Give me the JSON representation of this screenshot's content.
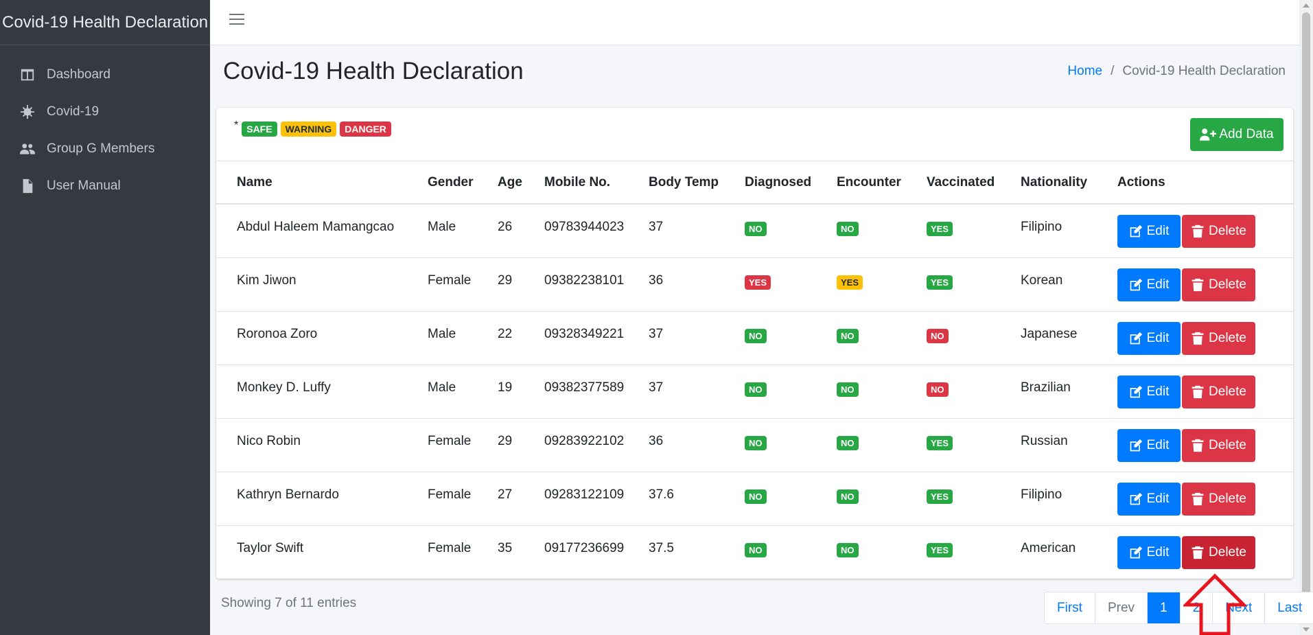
{
  "sidebar": {
    "brand": "Covid-19 Health Declaration",
    "items": [
      {
        "label": "Dashboard",
        "icon": "columns-icon"
      },
      {
        "label": "Covid-19",
        "icon": "virus-icon"
      },
      {
        "label": "Group G Members",
        "icon": "users-icon"
      },
      {
        "label": "User Manual",
        "icon": "file-icon"
      }
    ]
  },
  "header": {
    "title": "Covid-19 Health Declaration",
    "breadcrumb": {
      "home": "Home",
      "separator": "/",
      "current": "Covid-19 Health Declaration"
    }
  },
  "legend": {
    "star": "*",
    "safe": "SAFE",
    "warning": "WARNING",
    "danger": "DANGER"
  },
  "add_button": "Add Data",
  "table": {
    "columns": [
      "Name",
      "Gender",
      "Age",
      "Mobile No.",
      "Body Temp",
      "Diagnosed",
      "Encounter",
      "Vaccinated",
      "Nationality",
      "Actions"
    ],
    "rows": [
      {
        "name": "Abdul Haleem Mamangcao",
        "gender": "Male",
        "age": "26",
        "mobile": "09783944023",
        "temp": "37",
        "diagnosed": "NO",
        "encounter": "NO",
        "vaccinated": "YES",
        "nationality": "Filipino"
      },
      {
        "name": "Kim Jiwon",
        "gender": "Female",
        "age": "29",
        "mobile": "09382238101",
        "temp": "36",
        "diagnosed": "YES",
        "encounter": "YES",
        "vaccinated": "YES",
        "nationality": "Korean"
      },
      {
        "name": "Roronoa Zoro",
        "gender": "Male",
        "age": "22",
        "mobile": "09328349221",
        "temp": "37",
        "diagnosed": "NO",
        "encounter": "NO",
        "vaccinated": "NO",
        "nationality": "Japanese"
      },
      {
        "name": "Monkey D. Luffy",
        "gender": "Male",
        "age": "19",
        "mobile": "09382377589",
        "temp": "37",
        "diagnosed": "NO",
        "encounter": "NO",
        "vaccinated": "NO",
        "nationality": "Brazilian"
      },
      {
        "name": "Nico Robin",
        "gender": "Female",
        "age": "29",
        "mobile": "09283922102",
        "temp": "36",
        "diagnosed": "NO",
        "encounter": "NO",
        "vaccinated": "YES",
        "nationality": "Russian"
      },
      {
        "name": "Kathryn Bernardo",
        "gender": "Female",
        "age": "27",
        "mobile": "09283122109",
        "temp": "37.6",
        "diagnosed": "NO",
        "encounter": "NO",
        "vaccinated": "YES",
        "nationality": "Filipino"
      },
      {
        "name": "Taylor Swift",
        "gender": "Female",
        "age": "35",
        "mobile": "09177236699",
        "temp": "37.5",
        "diagnosed": "NO",
        "encounter": "NO",
        "vaccinated": "YES",
        "nationality": "American"
      }
    ],
    "edit_label": "Edit",
    "delete_label": "Delete"
  },
  "footer": {
    "showing": "Showing 7 of 11 entries",
    "pagination": [
      "First",
      "Prev",
      "1",
      "2",
      "Next",
      "Last"
    ],
    "active_page": "1"
  },
  "colors": {
    "safe": "#28a745",
    "warning": "#ffc107",
    "danger": "#dc3545",
    "primary": "#007bff",
    "sidebar": "#343a40"
  }
}
